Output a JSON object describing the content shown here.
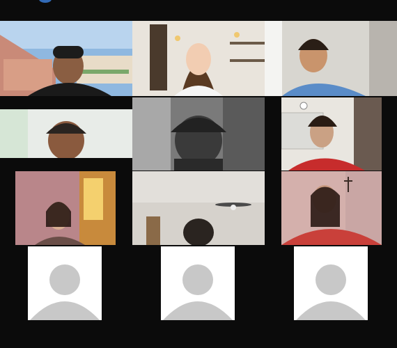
{
  "meeting": {
    "participants": [
      {
        "id": "p1",
        "name": "",
        "video": true
      },
      {
        "id": "p2",
        "name": "",
        "video": true
      },
      {
        "id": "p3",
        "name": "",
        "video": true
      },
      {
        "id": "p4",
        "name": "",
        "video": true
      },
      {
        "id": "p5",
        "name": "",
        "video": true
      },
      {
        "id": "p6",
        "name": "",
        "video": true
      },
      {
        "id": "p7",
        "name": "",
        "video": true
      },
      {
        "id": "p8",
        "name": "",
        "video": true
      },
      {
        "id": "p9",
        "name": "",
        "video": true
      },
      {
        "id": "p10",
        "name": "",
        "video": false,
        "icon": "default-avatar-icon"
      },
      {
        "id": "p11",
        "name": "",
        "video": false,
        "icon": "default-avatar-icon"
      },
      {
        "id": "p12",
        "name": "",
        "video": false,
        "icon": "default-avatar-icon"
      }
    ]
  },
  "colors": {
    "background": "#0b0b0b",
    "avatar_bg": "#ffffff",
    "avatar_fg": "#c8c8c8"
  }
}
